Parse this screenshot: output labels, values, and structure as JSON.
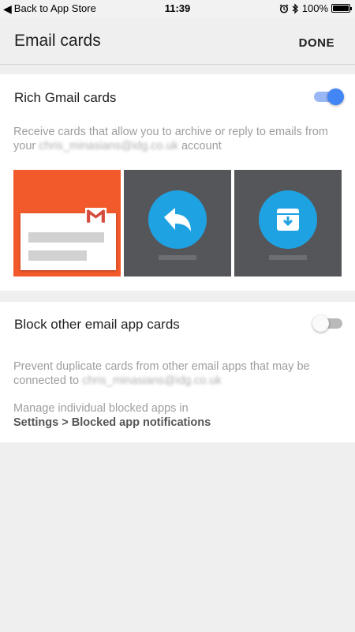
{
  "status_bar": {
    "back_label": "Back to App Store",
    "time": "11:39",
    "battery": "100%"
  },
  "app_bar": {
    "title": "Email cards",
    "done_label": "DONE"
  },
  "rich_gmail": {
    "label": "Rich Gmail cards",
    "enabled": true,
    "desc_line1": "Receive cards that allow you to archive or reply to emails from",
    "desc_prefix": "your ",
    "email_blurred": "chris_minasians@idg.co.uk",
    "desc_suffix": " account"
  },
  "block_other": {
    "label": "Block other email app cards",
    "enabled": false,
    "desc_line1": "Prevent duplicate cards from other email apps that may be",
    "desc_prefix": "connected to ",
    "email_blurred": "chris_minasians@idg.co.uk",
    "manage_line": "Manage individual blocked apps in",
    "settings_path": "Settings > Blocked app notifications"
  },
  "colors": {
    "gmail_tile": "#f2592b",
    "dark_tile": "#555659",
    "action_circle": "#1fa2e2",
    "toggle_on": "#4285f4"
  },
  "icons": {
    "tile_1": "gmail-envelope-icon",
    "tile_2": "reply-icon",
    "tile_3": "archive-icon"
  }
}
